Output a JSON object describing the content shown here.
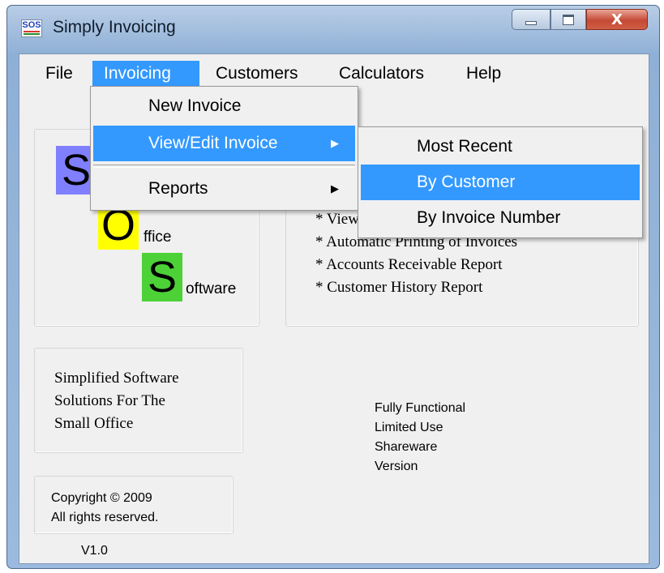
{
  "window": {
    "title": "Simply Invoicing",
    "icon_label": "SOS",
    "close_glyph": "X"
  },
  "menu": {
    "file": "File",
    "invoicing": "Invoicing",
    "customers": "Customers",
    "calculators": "Calculators",
    "help": "Help"
  },
  "invoicing_menu": {
    "new_invoice": "New Invoice",
    "view_edit_invoice": "View/Edit Invoice",
    "reports": "Reports",
    "submenu_arrow": "▶"
  },
  "view_edit_submenu": {
    "most_recent": "Most Recent",
    "by_customer": "By Customer",
    "by_invoice_number": "By Invoice Number"
  },
  "logo": {
    "s1": "S",
    "o": "O",
    "o_text": "ffice",
    "s2": "S",
    "s2_text": "oftware",
    "colors": {
      "s1": "#8080ff",
      "o": "#ffff00",
      "s2": "#4cd137"
    }
  },
  "features": {
    "line1": "* View/Edit Invoices",
    "line2": "* Automatic Printing of Invoices",
    "line3": "* Accounts Receivable Report",
    "line4": "* Customer History Report"
  },
  "tagline": {
    "line1": "Simplified Software",
    "line2": "Solutions For The",
    "line3": "Small Office"
  },
  "copyright": {
    "line1": "Copyright ©  2009",
    "line2": "All rights reserved."
  },
  "version_info": {
    "line1": "Fully Functional",
    "line2": "Limited Use",
    "line3": "Shareware",
    "line4": "Version"
  },
  "version": "V1.0"
}
